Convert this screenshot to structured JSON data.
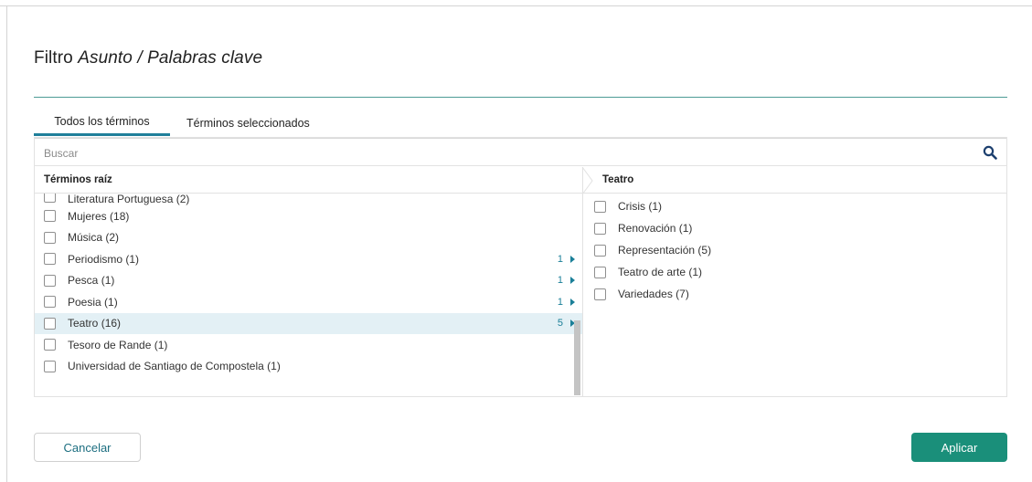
{
  "dialog": {
    "title_plain": "Filtro ",
    "title_italic": "Asunto / Palabras clave"
  },
  "tabs": [
    {
      "label": "Todos los términos",
      "active": true
    },
    {
      "label": "Términos seleccionados",
      "active": false
    }
  ],
  "search": {
    "placeholder": "Buscar",
    "value": ""
  },
  "left_column": {
    "header": "Términos raíz",
    "items": [
      {
        "label": "Literatura Portuguesa",
        "count": "(2)",
        "sub": ""
      },
      {
        "label": "Mujeres",
        "count": "(18)",
        "sub": ""
      },
      {
        "label": "Música",
        "count": "(2)",
        "sub": ""
      },
      {
        "label": "Periodismo",
        "count": "(1)",
        "sub": "1"
      },
      {
        "label": "Pesca",
        "count": "(1)",
        "sub": "1"
      },
      {
        "label": "Poesia",
        "count": "(1)",
        "sub": "1"
      },
      {
        "label": "Teatro",
        "count": "(16)",
        "sub": "5"
      },
      {
        "label": "Tesoro de Rande",
        "count": "(1)",
        "sub": ""
      },
      {
        "label": "Universidad de Santiago de Compostela",
        "count": "(1)",
        "sub": ""
      }
    ]
  },
  "right_column": {
    "header": "Teatro",
    "items": [
      {
        "label": "Crisis",
        "count": "(1)"
      },
      {
        "label": "Renovación",
        "count": "(1)"
      },
      {
        "label": "Representación",
        "count": "(5)"
      },
      {
        "label": "Teatro de arte",
        "count": "(1)"
      },
      {
        "label": "Variedades",
        "count": "(7)"
      }
    ]
  },
  "buttons": {
    "cancel": "Cancelar",
    "apply": "Aplicar"
  },
  "colors": {
    "accent": "#1a8f7a",
    "link": "#1a7f98",
    "selected_row": "#e3f0f5",
    "title_rule": "#4d9b95"
  }
}
